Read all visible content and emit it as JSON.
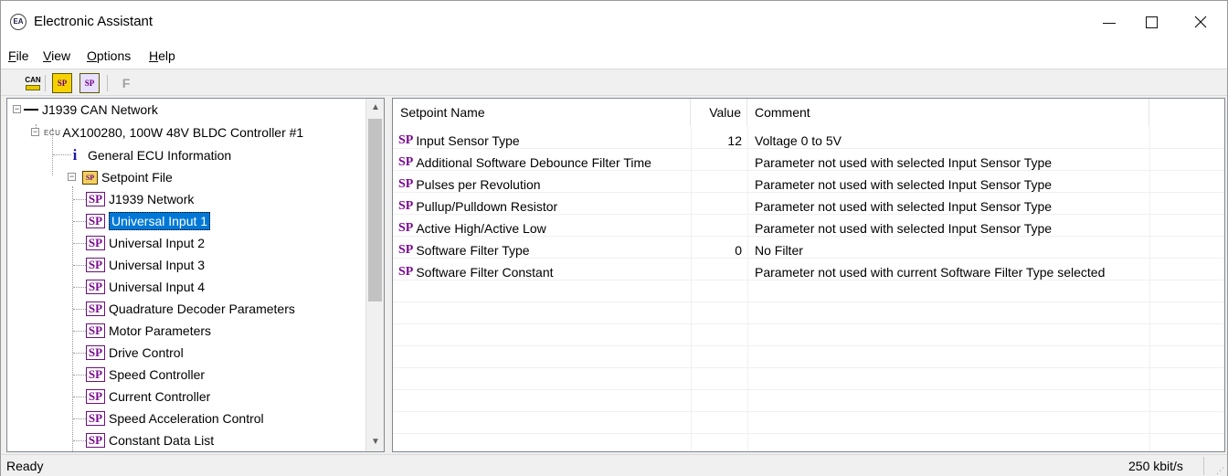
{
  "window": {
    "title": "Electronic Assistant"
  },
  "menu": [
    "File",
    "View",
    "Options",
    "Help"
  ],
  "toolbar": {
    "can_label": "CAN",
    "sp_label": "SP",
    "f_label": "F"
  },
  "tree": {
    "network": "J1939 CAN Network",
    "ecu_tag": "ECU",
    "ecu": "AX100280, 100W 48V BLDC Controller #1",
    "general_info": "General ECU Information",
    "setpoint_file": "Setpoint File",
    "sp_icon": "SP",
    "setpoints": [
      "J1939 Network",
      "Universal Input 1",
      "Universal Input 2",
      "Universal Input 3",
      "Universal Input 4",
      "Quadrature Decoder Parameters",
      "Motor Parameters",
      "Drive Control",
      "Speed Controller",
      "Current Controller",
      "Speed Acceleration Control",
      "Constant Data List"
    ],
    "selected": "Universal Input 1"
  },
  "table": {
    "headers": [
      "Setpoint Name",
      "Value",
      "Comment"
    ],
    "sp_mark": "SP",
    "rows": [
      {
        "name": "Input Sensor Type",
        "value": "12",
        "comment": "Voltage 0 to 5V"
      },
      {
        "name": "Additional Software Debounce Filter Time",
        "value": "",
        "comment": "Parameter not used with selected Input Sensor Type"
      },
      {
        "name": "Pulses per Revolution",
        "value": "",
        "comment": "Parameter not used with selected Input Sensor Type"
      },
      {
        "name": "Pullup/Pulldown Resistor",
        "value": "",
        "comment": "Parameter not used with selected Input Sensor Type"
      },
      {
        "name": "Active High/Active Low",
        "value": "",
        "comment": "Parameter not used with selected Input Sensor Type"
      },
      {
        "name": "Software Filter Type",
        "value": "0",
        "comment": "No Filter"
      },
      {
        "name": "Software Filter Constant",
        "value": "",
        "comment": "Parameter not used with current Software Filter Type selected"
      }
    ]
  },
  "status": {
    "text": "Ready",
    "rate": "250 kbit/s"
  },
  "colors": {
    "selection": "#0078d7",
    "sp_purple": "#7a0a90"
  }
}
